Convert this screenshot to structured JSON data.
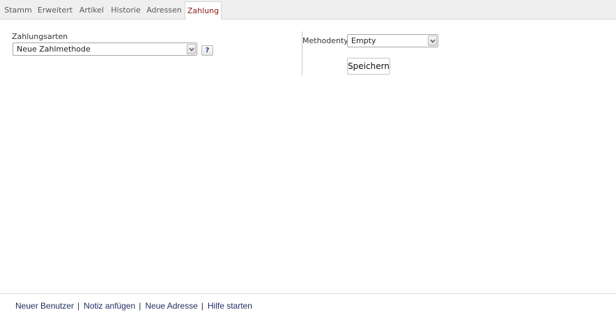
{
  "tabs": [
    {
      "label": "Stamm"
    },
    {
      "label": "Erweitert"
    },
    {
      "label": "Artikel"
    },
    {
      "label": "Historie"
    },
    {
      "label": "Adressen"
    },
    {
      "label": "Zahlung",
      "active": true
    }
  ],
  "payment_types": {
    "label": "Zahlungsarten",
    "selected": "Neue Zahlmethode",
    "help_label": "?"
  },
  "method_type": {
    "label": "Methodentyp",
    "selected": "Empty"
  },
  "save_button": {
    "label": "Speichern"
  },
  "footer": {
    "links": [
      {
        "label": "Neuer Benutzer"
      },
      {
        "label": "Notiz anfügen"
      },
      {
        "label": "Neue Adresse"
      },
      {
        "label": "Hilfe starten"
      }
    ],
    "separator": "|"
  },
  "colors": {
    "active_tab": "#8b1a1a",
    "tab_bar_bg": "#efefef",
    "help_icon": "#1f3f8a",
    "footer_link": "#1e2b5e"
  },
  "icons": {
    "select_arrow": "chevron-down-icon",
    "help": "help-icon"
  }
}
